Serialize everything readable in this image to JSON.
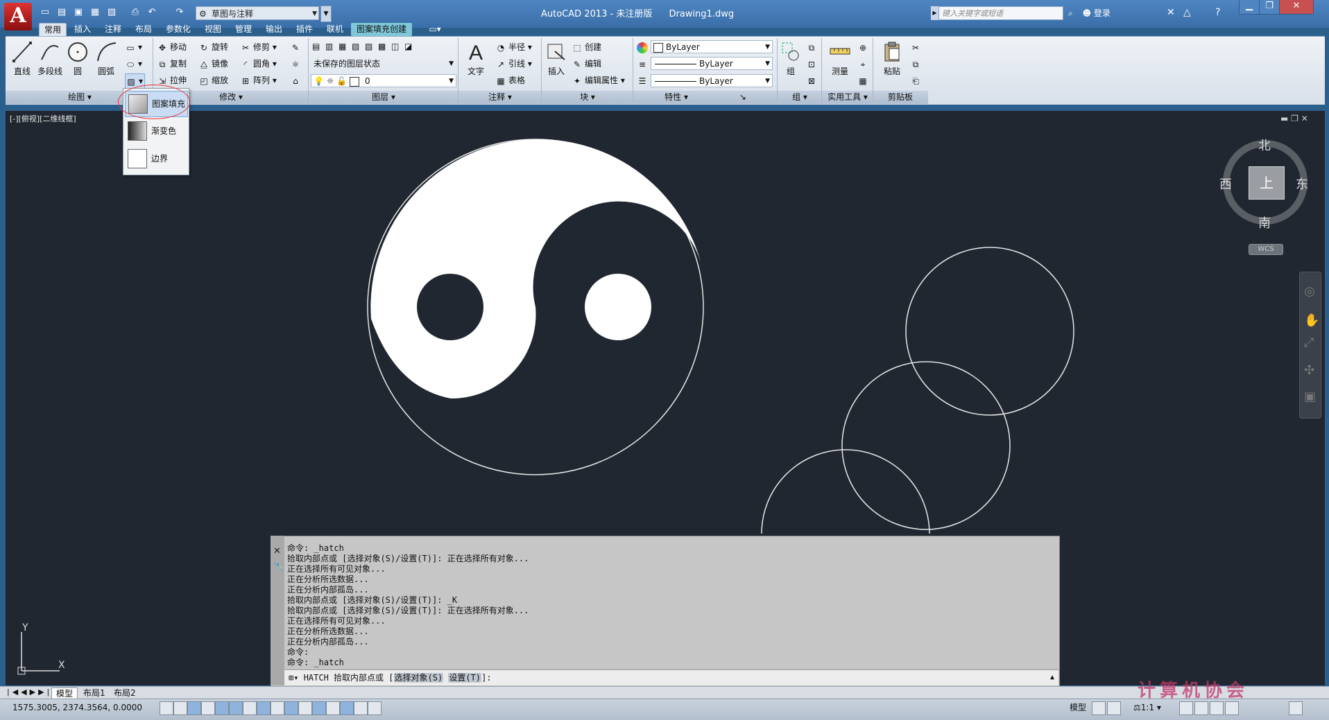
{
  "app": {
    "logo_letter": "A",
    "title": "AutoCAD 2013 - 未注册版",
    "filename": "Drawing1.dwg",
    "workspace": "草图与注释",
    "search_placeholder": "键入关键字或短语",
    "login": "登录"
  },
  "tabs": [
    "常用",
    "插入",
    "注释",
    "布局",
    "参数化",
    "视图",
    "管理",
    "输出",
    "插件",
    "联机",
    "图案填充创建"
  ],
  "ribbon": {
    "draw": {
      "line": "直线",
      "polyline": "多段线",
      "circle": "圆",
      "arc": "圆弧",
      "panel": "绘图"
    },
    "modify": {
      "move": "移动",
      "rotate": "旋转",
      "trim": "修剪",
      "copy": "复制",
      "mirror": "镜像",
      "fillet": "圆角",
      "stretch": "拉伸",
      "scale": "缩放",
      "array": "阵列",
      "panel": "修改"
    },
    "layers": {
      "state": "未保存的图层状态",
      "current": "0",
      "panel": "图层"
    },
    "annotation": {
      "text": "文字",
      "radius": "半径",
      "leader": "引线",
      "table": "表格",
      "panel": "注释"
    },
    "block": {
      "insert": "插入",
      "create": "创建",
      "edit": "编辑",
      "edit_attr": "编辑属性",
      "panel": "块"
    },
    "properties": {
      "color": "ByLayer",
      "linetype": "ByLayer",
      "lineweight": "ByLayer",
      "panel": "特性"
    },
    "groups": {
      "group": "组",
      "panel": "组"
    },
    "utilities": {
      "measure": "测量",
      "panel": "实用工具"
    },
    "clipboard": {
      "paste": "粘贴",
      "panel": "剪贴板"
    }
  },
  "hatch_menu": {
    "items": [
      "图案填充",
      "渐变色",
      "边界"
    ]
  },
  "viewport": {
    "label": "[-][俯视][二维线框]",
    "controls": "▬ ❐ ✕"
  },
  "viewcube": {
    "north": "北",
    "south": "南",
    "east": "东",
    "west": "西",
    "face": "上",
    "wcs": "WCS"
  },
  "ucs": {
    "x": "X",
    "y": "Y"
  },
  "command": {
    "history": "命令: _hatch\n拾取内部点或 [选择对象(S)/设置(T)]: 正在选择所有对象...\n正在选择所有可见对象...\n正在分析所选数据...\n正在分析内部孤岛...\n拾取内部点或 [选择对象(S)/设置(T)]: _K\n拾取内部点或 [选择对象(S)/设置(T)]: 正在选择所有对象...\n正在选择所有可见对象...\n正在分析所选数据...\n正在分析内部孤岛...\n命令:\n命令: _hatch",
    "prompt_prefix": "HATCH 拾取内部点或 [",
    "opt1": "选择对象(S)",
    "opt2": "设置(T)",
    "prompt_suffix": "]:"
  },
  "layout_tabs": [
    "模型",
    "布局1",
    "布局2"
  ],
  "status": {
    "coords": "1575.3005,  2374.3564,  0.0000",
    "model": "模型",
    "scale": "1:1"
  },
  "watermark": "计算机协会"
}
